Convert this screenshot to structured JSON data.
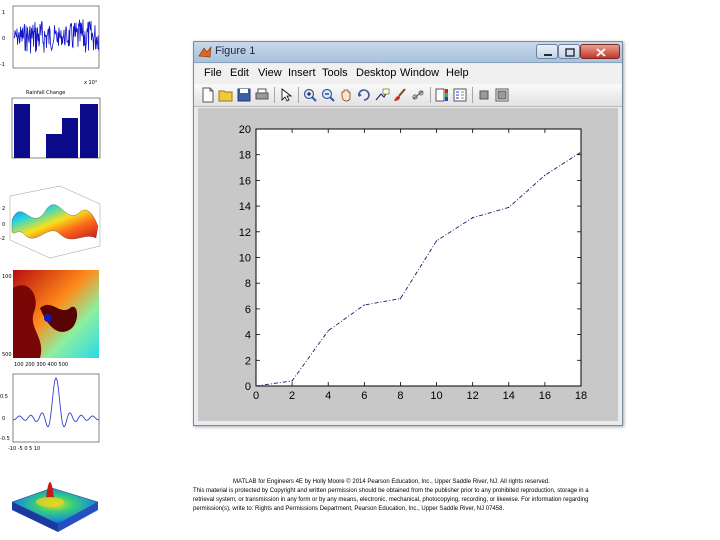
{
  "window": {
    "title": "Figure 1"
  },
  "menu": [
    "File",
    "Edit",
    "View",
    "Insert",
    "Tools",
    "Desktop",
    "Window",
    "Help"
  ],
  "toolbar_icons": [
    "new-figure-icon",
    "open-file-icon",
    "save-icon",
    "print-icon",
    "pointer-icon",
    "zoom-in-icon",
    "zoom-out-icon",
    "pan-hand-icon",
    "rotate-3d-icon",
    "data-cursor-icon",
    "brush-icon",
    "link-icon",
    "colorbar-icon",
    "legend-icon",
    "hide-plot-tools-icon",
    "show-plot-tools-icon"
  ],
  "thumbnails": {
    "panel2_title": "Rainfall Change",
    "panel1_xscale": "x 10⁴"
  },
  "chart_data": {
    "type": "line",
    "x": [
      0,
      2,
      4,
      6,
      8,
      10,
      12,
      14,
      16,
      18
    ],
    "y": [
      0,
      0.4,
      4.3,
      6.3,
      6.8,
      11.3,
      13.1,
      13.9,
      16.4,
      18.2
    ],
    "xlim": [
      0,
      18
    ],
    "ylim": [
      0,
      20
    ],
    "xticks": [
      "0",
      "2",
      "4",
      "6",
      "8",
      "10",
      "12",
      "14",
      "16",
      "18"
    ],
    "yticks": [
      "0",
      "2",
      "4",
      "6",
      "8",
      "10",
      "12",
      "14",
      "16",
      "18",
      "20"
    ],
    "line_style": "dash-dot",
    "line_color": "#1a1a66",
    "grid": false,
    "axes_background": "#ffffff",
    "figure_background": "#c8c8c8"
  },
  "caption": {
    "line1": "MATLAB for Engineers 4E by Holly Moore © 2014 Pearson Education, Inc., Upper Saddle River, NJ. All rights reserved.",
    "line2": "This material is protected by Copyright and written permission should be obtained from the publisher prior to any prohibited reproduction, storage in a",
    "line3": "retrieval system, or transmission in any form or by any means, electronic, mechanical, photocopying, recording, or likewise. For information regarding",
    "line4": "permission(s), write to: Rights and Permissions Department, Pearson Education, Inc., Upper Saddle River, NJ 07458."
  }
}
